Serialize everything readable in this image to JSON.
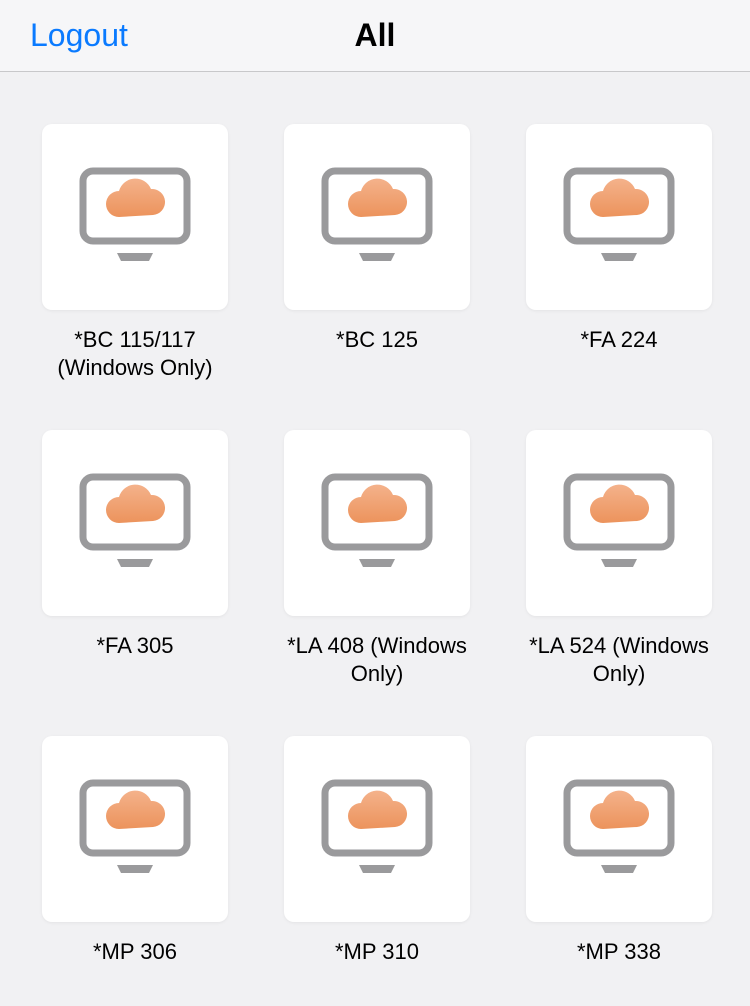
{
  "header": {
    "logout": "Logout",
    "title": "All"
  },
  "items": [
    {
      "label": "*BC 115/117 (Windows Only)"
    },
    {
      "label": "*BC 125"
    },
    {
      "label": "*FA 224"
    },
    {
      "label": "*FA 305"
    },
    {
      "label": "*LA 408 (Windows Only)"
    },
    {
      "label": "*LA 524 (Windows Only)"
    },
    {
      "label": "*MP 306"
    },
    {
      "label": "*MP 310"
    },
    {
      "label": "*MP 338"
    }
  ]
}
